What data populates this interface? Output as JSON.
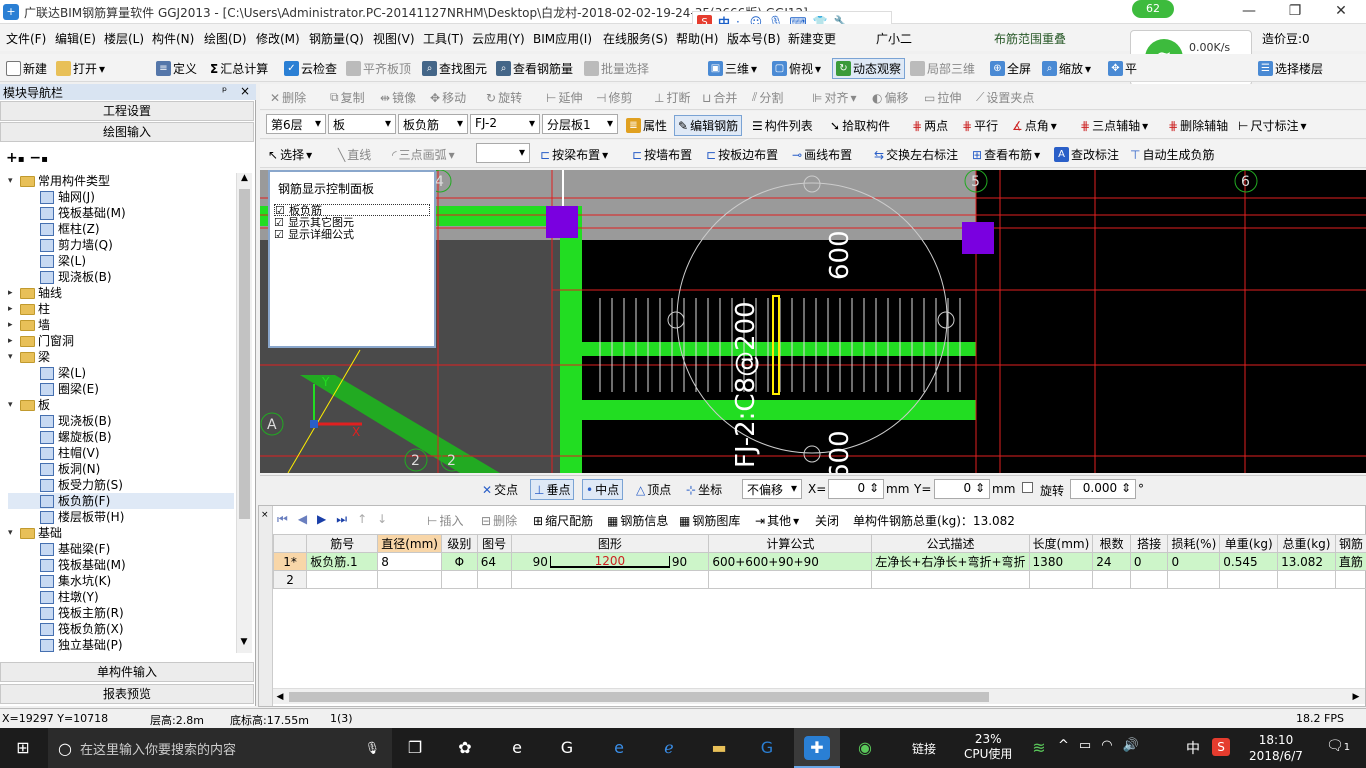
{
  "title_bar": {
    "title": "广联达BIM钢筋算量软件 GGJ2013 - [C:\\Users\\Administrator.PC-20141127NRHM\\Desktop\\白龙村-2018-02-02-19-24-35(3666版).GGJ12]",
    "minimize": "—",
    "restore": "❐",
    "close": "✕"
  },
  "menu": {
    "items": [
      "文件(F)",
      "编辑(E)",
      "楼层(L)",
      "构件(N)",
      "绘图(D)",
      "修改(M)",
      "钢筋量(Q)",
      "视图(V)",
      "工具(T)",
      "云应用(Y)",
      "BIM应用(I)",
      "在线服务(S)",
      "帮助(H)",
      "版本号(B)",
      "新建变更",
      "广小二"
    ],
    "right_text": "布筋范围重叠",
    "coins": "造价豆:0"
  },
  "toolbar1": {
    "items": [
      "新建",
      "打开",
      "定义",
      "汇总计算",
      "云检查",
      "平齐板顶",
      "查找图元",
      "查看钢筋量",
      "批量选择",
      "三维",
      "俯视",
      "动态观察",
      "局部三维",
      "全屏",
      "缩放",
      "平",
      "选择楼层"
    ]
  },
  "toolbar2": {
    "items": [
      "删除",
      "复制",
      "镜像",
      "移动",
      "旋转",
      "延伸",
      "修剪",
      "打断",
      "合并",
      "分割",
      "对齐",
      "偏移",
      "拉伸",
      "设置夹点"
    ]
  },
  "toolbar3": {
    "floor": "第6层",
    "type": "板",
    "subtype": "板负筋",
    "code": "FJ-2",
    "layer": "分层板1",
    "items": [
      "属性",
      "编辑钢筋",
      "构件列表",
      "拾取构件",
      "两点",
      "平行",
      "点角",
      "三点辅轴",
      "删除辅轴",
      "尺寸标注"
    ]
  },
  "toolbar4": {
    "items": [
      "选择",
      "直线",
      "三点画弧",
      "按梁布置",
      "按墙布置",
      "按板边布置",
      "画线布置",
      "交换左右标注",
      "查看布筋",
      "查改标注",
      "自动生成负筋"
    ]
  },
  "left_panel": {
    "header": "模块导航栏",
    "pin": "ᵖ",
    "close": "×",
    "tabs": [
      "工程设置",
      "绘图输入"
    ],
    "bottom_tabs": [
      "单构件输入",
      "报表预览"
    ],
    "tree": [
      {
        "level": 0,
        "toggle": "▾",
        "kind": "folder",
        "label": "常用构件类型"
      },
      {
        "level": 1,
        "toggle": "",
        "kind": "item",
        "label": "轴网(J)"
      },
      {
        "level": 1,
        "toggle": "",
        "kind": "item",
        "label": "筏板基础(M)"
      },
      {
        "level": 1,
        "toggle": "",
        "kind": "item",
        "label": "框柱(Z)"
      },
      {
        "level": 1,
        "toggle": "",
        "kind": "item",
        "label": "剪力墙(Q)"
      },
      {
        "level": 1,
        "toggle": "",
        "kind": "item",
        "label": "梁(L)"
      },
      {
        "level": 1,
        "toggle": "",
        "kind": "item",
        "label": "现浇板(B)"
      },
      {
        "level": 0,
        "toggle": "▸",
        "kind": "folder",
        "label": "轴线"
      },
      {
        "level": 0,
        "toggle": "▸",
        "kind": "folder",
        "label": "柱"
      },
      {
        "level": 0,
        "toggle": "▸",
        "kind": "folder",
        "label": "墙"
      },
      {
        "level": 0,
        "toggle": "▸",
        "kind": "folder",
        "label": "门窗洞"
      },
      {
        "level": 0,
        "toggle": "▾",
        "kind": "folder",
        "label": "梁"
      },
      {
        "level": 1,
        "toggle": "",
        "kind": "item",
        "label": "梁(L)"
      },
      {
        "level": 1,
        "toggle": "",
        "kind": "item",
        "label": "圈梁(E)"
      },
      {
        "level": 0,
        "toggle": "▾",
        "kind": "folder",
        "label": "板"
      },
      {
        "level": 1,
        "toggle": "",
        "kind": "item",
        "label": "现浇板(B)"
      },
      {
        "level": 1,
        "toggle": "",
        "kind": "item",
        "label": "螺旋板(B)"
      },
      {
        "level": 1,
        "toggle": "",
        "kind": "item",
        "label": "柱帽(V)"
      },
      {
        "level": 1,
        "toggle": "",
        "kind": "item",
        "label": "板洞(N)"
      },
      {
        "level": 1,
        "toggle": "",
        "kind": "item",
        "label": "板受力筋(S)"
      },
      {
        "level": 1,
        "toggle": "",
        "kind": "item",
        "label": "板负筋(F)",
        "selected": true
      },
      {
        "level": 1,
        "toggle": "",
        "kind": "item",
        "label": "楼层板带(H)"
      },
      {
        "level": 0,
        "toggle": "▾",
        "kind": "folder",
        "label": "基础"
      },
      {
        "level": 1,
        "toggle": "",
        "kind": "item",
        "label": "基础梁(F)"
      },
      {
        "level": 1,
        "toggle": "",
        "kind": "item",
        "label": "筏板基础(M)"
      },
      {
        "level": 1,
        "toggle": "",
        "kind": "item",
        "label": "集水坑(K)"
      },
      {
        "level": 1,
        "toggle": "",
        "kind": "item",
        "label": "柱墩(Y)"
      },
      {
        "level": 1,
        "toggle": "",
        "kind": "item",
        "label": "筏板主筋(R)"
      },
      {
        "level": 1,
        "toggle": "",
        "kind": "item",
        "label": "筏板负筋(X)"
      },
      {
        "level": 1,
        "toggle": "",
        "kind": "item",
        "label": "独立基础(P)"
      }
    ]
  },
  "control_panel": {
    "title": "钢筋显示控制面板",
    "options": [
      "板负筋",
      "显示其它图元",
      "显示详细公式"
    ]
  },
  "canvas": {
    "axis_labels": [
      "4",
      "5",
      "6",
      "2",
      "2",
      "A"
    ],
    "dim_top": "600",
    "dim_bottom": "600",
    "rebar_label": "FJ-2:C8@200",
    "axis_x": "X",
    "axis_y": "Y"
  },
  "network_widget": {
    "badge": "62",
    "speed": "0.00K/s",
    "up": "0"
  },
  "snap_bar": {
    "items": [
      "交点",
      "垂点",
      "中点",
      "顶点",
      "坐标"
    ],
    "offset_mode": "不偏移",
    "x_label": "X=",
    "x_value": "0",
    "x_unit": "mm",
    "y_label": "Y=",
    "y_value": "0",
    "y_unit": "mm",
    "rotate_label": "旋转",
    "rotate_value": "0.000",
    "rotate_unit": "°"
  },
  "bottom_toolbar": {
    "items": [
      "插入",
      "删除",
      "缩尺配筋",
      "钢筋信息",
      "钢筋图库",
      "其他",
      "关闭"
    ],
    "summary": "单构件钢筋总重(kg)：13.082"
  },
  "rebar_table": {
    "columns": [
      "",
      "筋号",
      "直径(mm)",
      "级别",
      "图号",
      "图形",
      "计算公式",
      "公式描述",
      "长度(mm)",
      "根数",
      "搭接",
      "损耗(%)",
      "单重(kg)",
      "总重(kg)",
      "钢筋"
    ],
    "rows": [
      {
        "num": "1*",
        "name": "板负筋.1",
        "dia": "8",
        "grade": "Φ",
        "fig": "64",
        "shape_left": "90",
        "shape_mid": "1200",
        "shape_right": "90",
        "formula": "600+600+90+90",
        "desc": "左净长+右净长+弯折+弯折",
        "length": "1380",
        "count": "24",
        "lap": "0",
        "loss": "0",
        "unit_w": "0.545",
        "total_w": "13.082",
        "type": "直筋"
      },
      {
        "num": "2",
        "name": "",
        "dia": "",
        "grade": "",
        "fig": "",
        "shape_left": "",
        "shape_mid": "",
        "shape_right": "",
        "formula": "",
        "desc": "",
        "length": "",
        "count": "",
        "lap": "",
        "loss": "",
        "unit_w": "",
        "total_w": "",
        "type": ""
      }
    ]
  },
  "status_bar": {
    "coords": "X=19297 Y=10718",
    "floor_height": "层高:2.8m",
    "base_elev": "底标高:17.55m",
    "count": "1(3)",
    "fps": "18.2 FPS"
  },
  "taskbar": {
    "search_placeholder": "在这里输入你要搜索的内容",
    "cpu_percent": "23%",
    "cpu_label": "CPU使用",
    "link": "链接",
    "ime": "中",
    "time": "18:10",
    "date": "2018/6/7",
    "notif": "1"
  },
  "colors": {
    "accent": "#2a7fd4",
    "canvas_bg": "#000000",
    "slab_green": "#22dd22",
    "grid_red": "#e02020",
    "purple": "#7a00e0",
    "row_green": "#cdf5c9"
  }
}
